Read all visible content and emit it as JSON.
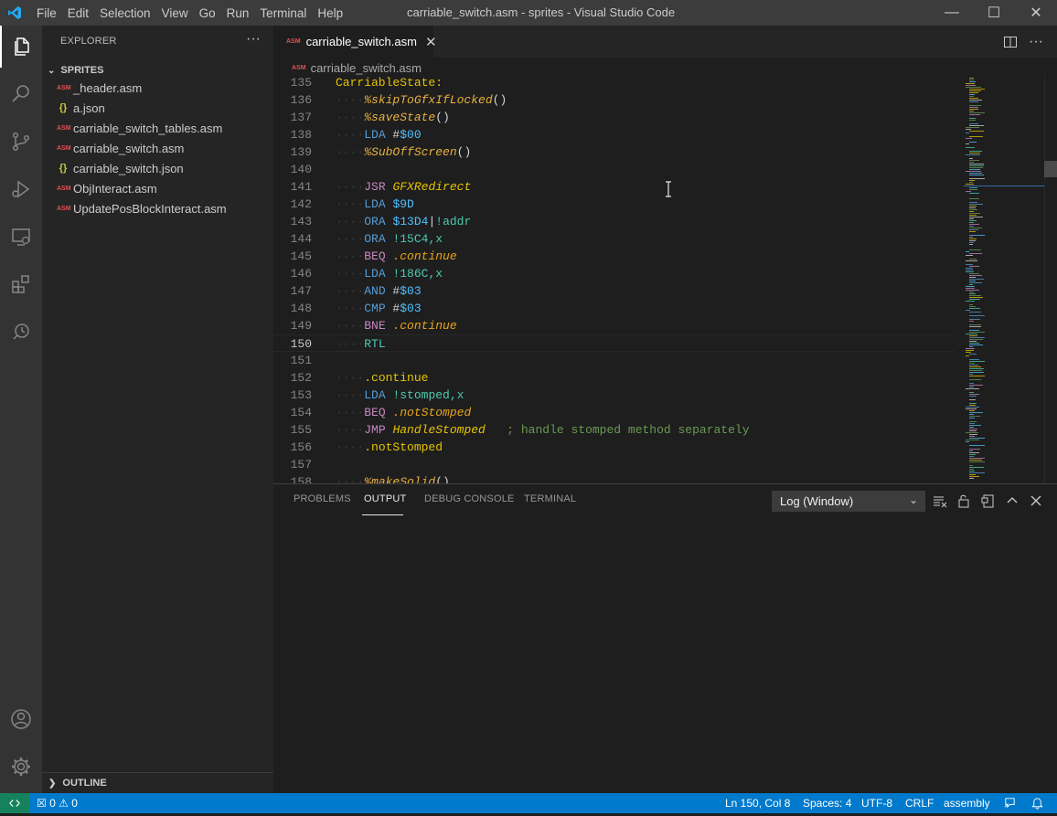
{
  "window": {
    "title": "carriable_switch.asm - sprites - Visual Studio Code",
    "menu": [
      "File",
      "Edit",
      "Selection",
      "View",
      "Go",
      "Run",
      "Terminal",
      "Help"
    ],
    "controls": {
      "minimize": "—",
      "maximize": "☐",
      "close": "✕"
    }
  },
  "sidebar": {
    "header": "EXPLORER",
    "more": "···",
    "folder": "SPRITES",
    "files": [
      {
        "name": "_header.asm",
        "icon": "ASM",
        "type": "asm"
      },
      {
        "name": "a.json",
        "icon": "{}",
        "type": "json"
      },
      {
        "name": "carriable_switch_tables.asm",
        "icon": "ASM",
        "type": "asm"
      },
      {
        "name": "carriable_switch.asm",
        "icon": "ASM",
        "type": "asm"
      },
      {
        "name": "carriable_switch.json",
        "icon": "{}",
        "type": "json"
      },
      {
        "name": "ObjInteract.asm",
        "icon": "ASM",
        "type": "asm"
      },
      {
        "name": "UpdatePosBlockInteract.asm",
        "icon": "ASM",
        "type": "asm"
      }
    ],
    "outline": "OUTLINE"
  },
  "editor": {
    "tab_label": "carriable_switch.asm",
    "tab_icon": "ASM",
    "tab_close": "✕",
    "breadcrumb": "carriable_switch.asm",
    "current_line": 150,
    "lines": [
      {
        "n": "135",
        "tokens": [
          [
            "t-label",
            "CarriableState:"
          ]
        ],
        "indent": 0
      },
      {
        "n": "136",
        "tokens": [
          [
            "t-macro",
            "%skipToGfxIfLocked"
          ],
          [
            "t-text",
            "()"
          ]
        ],
        "indent": 1
      },
      {
        "n": "137",
        "tokens": [
          [
            "t-macro",
            "%saveState"
          ],
          [
            "t-text",
            "()"
          ]
        ],
        "indent": 1
      },
      {
        "n": "138",
        "tokens": [
          [
            "t-op",
            "LDA"
          ],
          [
            "t-text",
            " #"
          ],
          [
            "t-num",
            "$00"
          ]
        ],
        "indent": 1
      },
      {
        "n": "139",
        "tokens": [
          [
            "t-macro",
            "%SubOffScreen"
          ],
          [
            "t-text",
            "()"
          ]
        ],
        "indent": 1
      },
      {
        "n": "140",
        "tokens": [],
        "indent": 0
      },
      {
        "n": "141",
        "tokens": [
          [
            "t-op2",
            "JSR"
          ],
          [
            "t-text",
            " "
          ],
          [
            "t-call",
            "GFXRedirect"
          ]
        ],
        "indent": 1
      },
      {
        "n": "142",
        "tokens": [
          [
            "t-op",
            "LDA"
          ],
          [
            "t-text",
            " "
          ],
          [
            "t-num",
            "$9D"
          ]
        ],
        "indent": 1
      },
      {
        "n": "143",
        "tokens": [
          [
            "t-op",
            "ORA"
          ],
          [
            "t-text",
            " "
          ],
          [
            "t-num",
            "$13D4"
          ],
          [
            "t-text",
            "|"
          ],
          [
            "t-ident",
            "!addr"
          ]
        ],
        "indent": 1
      },
      {
        "n": "144",
        "tokens": [
          [
            "t-op",
            "ORA"
          ],
          [
            "t-text",
            " "
          ],
          [
            "t-ident",
            "!15C4,x"
          ]
        ],
        "indent": 1
      },
      {
        "n": "145",
        "tokens": [
          [
            "t-op2",
            "BEQ"
          ],
          [
            "t-text",
            " "
          ],
          [
            "t-lbl",
            ".continue"
          ]
        ],
        "indent": 1
      },
      {
        "n": "146",
        "tokens": [
          [
            "t-op",
            "LDA"
          ],
          [
            "t-text",
            " "
          ],
          [
            "t-ident",
            "!186C,x"
          ]
        ],
        "indent": 1
      },
      {
        "n": "147",
        "tokens": [
          [
            "t-op",
            "AND"
          ],
          [
            "t-text",
            " #"
          ],
          [
            "t-num",
            "$03"
          ]
        ],
        "indent": 1
      },
      {
        "n": "148",
        "tokens": [
          [
            "t-op",
            "CMP"
          ],
          [
            "t-text",
            " #"
          ],
          [
            "t-num",
            "$03"
          ]
        ],
        "indent": 1
      },
      {
        "n": "149",
        "tokens": [
          [
            "t-op2",
            "BNE"
          ],
          [
            "t-text",
            " "
          ],
          [
            "t-lbl",
            ".continue"
          ]
        ],
        "indent": 1
      },
      {
        "n": "150",
        "tokens": [
          [
            "t-op3",
            "RTL"
          ]
        ],
        "indent": 1
      },
      {
        "n": "151",
        "tokens": [],
        "indent": 0
      },
      {
        "n": "152",
        "tokens": [
          [
            "t-label",
            ".continue"
          ]
        ],
        "indent": 1
      },
      {
        "n": "153",
        "tokens": [
          [
            "t-op",
            "LDA"
          ],
          [
            "t-text",
            " "
          ],
          [
            "t-ident",
            "!stomped,x"
          ]
        ],
        "indent": 1
      },
      {
        "n": "154",
        "tokens": [
          [
            "t-op2",
            "BEQ"
          ],
          [
            "t-text",
            " "
          ],
          [
            "t-lbl",
            ".notStomped"
          ]
        ],
        "indent": 1
      },
      {
        "n": "155",
        "tokens": [
          [
            "t-op2",
            "JMP"
          ],
          [
            "t-text",
            " "
          ],
          [
            "t-call",
            "HandleStomped"
          ],
          [
            "t-text",
            "   "
          ],
          [
            "t-cmt",
            "; handle stomped method separately"
          ]
        ],
        "indent": 1
      },
      {
        "n": "156",
        "tokens": [
          [
            "t-label",
            ".notStomped"
          ]
        ],
        "indent": 1
      },
      {
        "n": "157",
        "tokens": [],
        "indent": 0
      },
      {
        "n": "158",
        "tokens": [
          [
            "t-macro",
            "%makeSolid"
          ],
          [
            "t-text",
            "()"
          ]
        ],
        "indent": 1
      }
    ]
  },
  "panel": {
    "tabs": [
      "PROBLEMS",
      "OUTPUT",
      "DEBUG CONSOLE",
      "TERMINAL"
    ],
    "active_tab": "OUTPUT",
    "output_channel": "Log (Window)"
  },
  "statusbar": {
    "errors": "0",
    "warnings": "0",
    "position": "Ln 150, Col 8",
    "indent": "Spaces: 4",
    "encoding": "UTF-8",
    "eol": "CRLF",
    "language": "assembly"
  },
  "colors": {
    "accent": "#007acc",
    "remote": "#16825d",
    "activity_bar": "#333333",
    "sidebar": "#252526",
    "editor": "#1e1e1e"
  }
}
